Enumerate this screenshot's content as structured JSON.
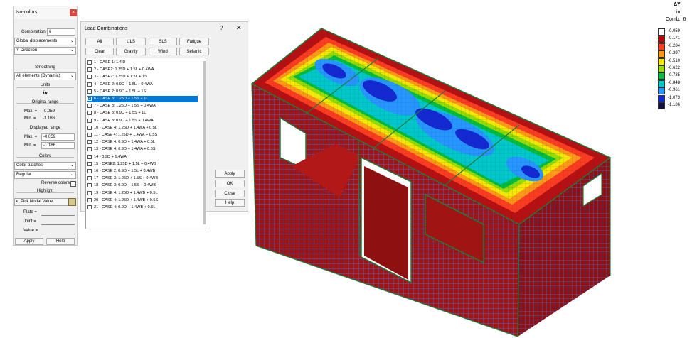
{
  "iso_panel": {
    "title": "Iso-colors",
    "combination_label": "Combination",
    "combination_value": "6",
    "result_type": "Global displacements",
    "direction": "Y Direction",
    "smoothing_header": "Smoothing",
    "smoothing_value": "All elements (Dynamic)",
    "units_header": "Units",
    "units_value": "in",
    "original_range_header": "Original range",
    "max_label": "Max. =",
    "min_label": "Min. =",
    "orig_max": "-0.059",
    "orig_min": "-1.186",
    "displayed_range_header": "Displayed range",
    "disp_max": "-0.059",
    "disp_min": "-1.186",
    "colors_header": "Colors",
    "colors_mode": "Color patches",
    "colors_scale": "Regular",
    "reverse_colors_label": "Reverse colors",
    "highlight_header": "Highlight",
    "pick_nodal_label": "Pick Nodal Value",
    "plate_label": "Plate =",
    "joint_label": "Joint =",
    "value_label": "Value =",
    "apply_label": "Apply",
    "help_label": "Help"
  },
  "load_dialog": {
    "title": "Load Combinations",
    "help_glyph": "?",
    "close_glyph": "✕",
    "filters_row1": [
      "All",
      "ULS",
      "SLS",
      "Fatigue"
    ],
    "filters_row2": [
      "Clear",
      "Gravity",
      "Wind",
      "Seismic"
    ],
    "combinations": [
      {
        "label": "1 - CASE 1: 1.4 D",
        "checked": false
      },
      {
        "label": "2 - CASE2: 1.25D + 1.5L + 0.4WA",
        "checked": false
      },
      {
        "label": "3 - CASE2: 1.25D + 1.5L + 1S",
        "checked": false
      },
      {
        "label": "4 - CASE 2: 0.9D + 1.5L + 0.4WA",
        "checked": false
      },
      {
        "label": "5 - CASE 2: 0.9D + 1.5L + 1S",
        "checked": false
      },
      {
        "label": "6 - CASE 3: 1.25D + 1.5S + 1L",
        "checked": true
      },
      {
        "label": "7 - CASE 3: 1.25D + 1.5S + 0.4WA",
        "checked": false
      },
      {
        "label": "8 - CASE 3: 0.9D + 1.5S + 1L",
        "checked": false
      },
      {
        "label": "9 - CASE 3: 0.9D + 1.5S + 0.4WA",
        "checked": false
      },
      {
        "label": "10 - CASE 4: 1.25D + 1.4WA + 0.5L",
        "checked": false
      },
      {
        "label": "11 - CASE 4: 1.25D + 1.4WA + 0.5S",
        "checked": false
      },
      {
        "label": "12 - CASE 4: 0.9D + 1.4WA + 0.5L",
        "checked": false
      },
      {
        "label": "13 - CASE 4: 0.9D + 1.4WA + 0.5S",
        "checked": false
      },
      {
        "label": "14 - 0.9D + 1.4WA",
        "checked": false
      },
      {
        "label": "15 - CASE2: 1.25D + 1.5L + 0.4WB",
        "checked": false
      },
      {
        "label": "16 - CASE 2: 0.9D + 1.5L + 0.4WB",
        "checked": false
      },
      {
        "label": "17 - CASE 3: 1.25D + 1.5S + 0.4WB",
        "checked": false
      },
      {
        "label": "18 - CASE 3: 0.9D + 1.5S + 0.4WB",
        "checked": false
      },
      {
        "label": "19 - CASE 4: 1.25D + 1.4WB + 0.5L",
        "checked": false
      },
      {
        "label": "20 - CASE 4: 1.25D + 1.4WB + 0.5S",
        "checked": false
      },
      {
        "label": "21 - CASE 4: 0.9D + 1.4WB + 0.5L",
        "checked": false
      }
    ],
    "side_buttons": [
      "Apply",
      "OK",
      "Close",
      "Help"
    ]
  },
  "legend": {
    "title": "ΔY",
    "units": "in",
    "combination": "Comb.: 6",
    "entries": [
      {
        "value": "-0.059",
        "color": "#ffffff"
      },
      {
        "value": "-0.171",
        "color": "#c00000"
      },
      {
        "value": "-0.284",
        "color": "#ff3c1e"
      },
      {
        "value": "-0.397",
        "color": "#ff9a14"
      },
      {
        "value": "-0.510",
        "color": "#f5e800"
      },
      {
        "value": "-0.622",
        "color": "#96dc00"
      },
      {
        "value": "-0.735",
        "color": "#00be3c"
      },
      {
        "value": "-0.848",
        "color": "#00c8c8"
      },
      {
        "value": "-0.961",
        "color": "#2896ff"
      },
      {
        "value": "-1.073",
        "color": "#1428d2"
      },
      {
        "value": "-1.186",
        "color": "#101040"
      }
    ]
  }
}
